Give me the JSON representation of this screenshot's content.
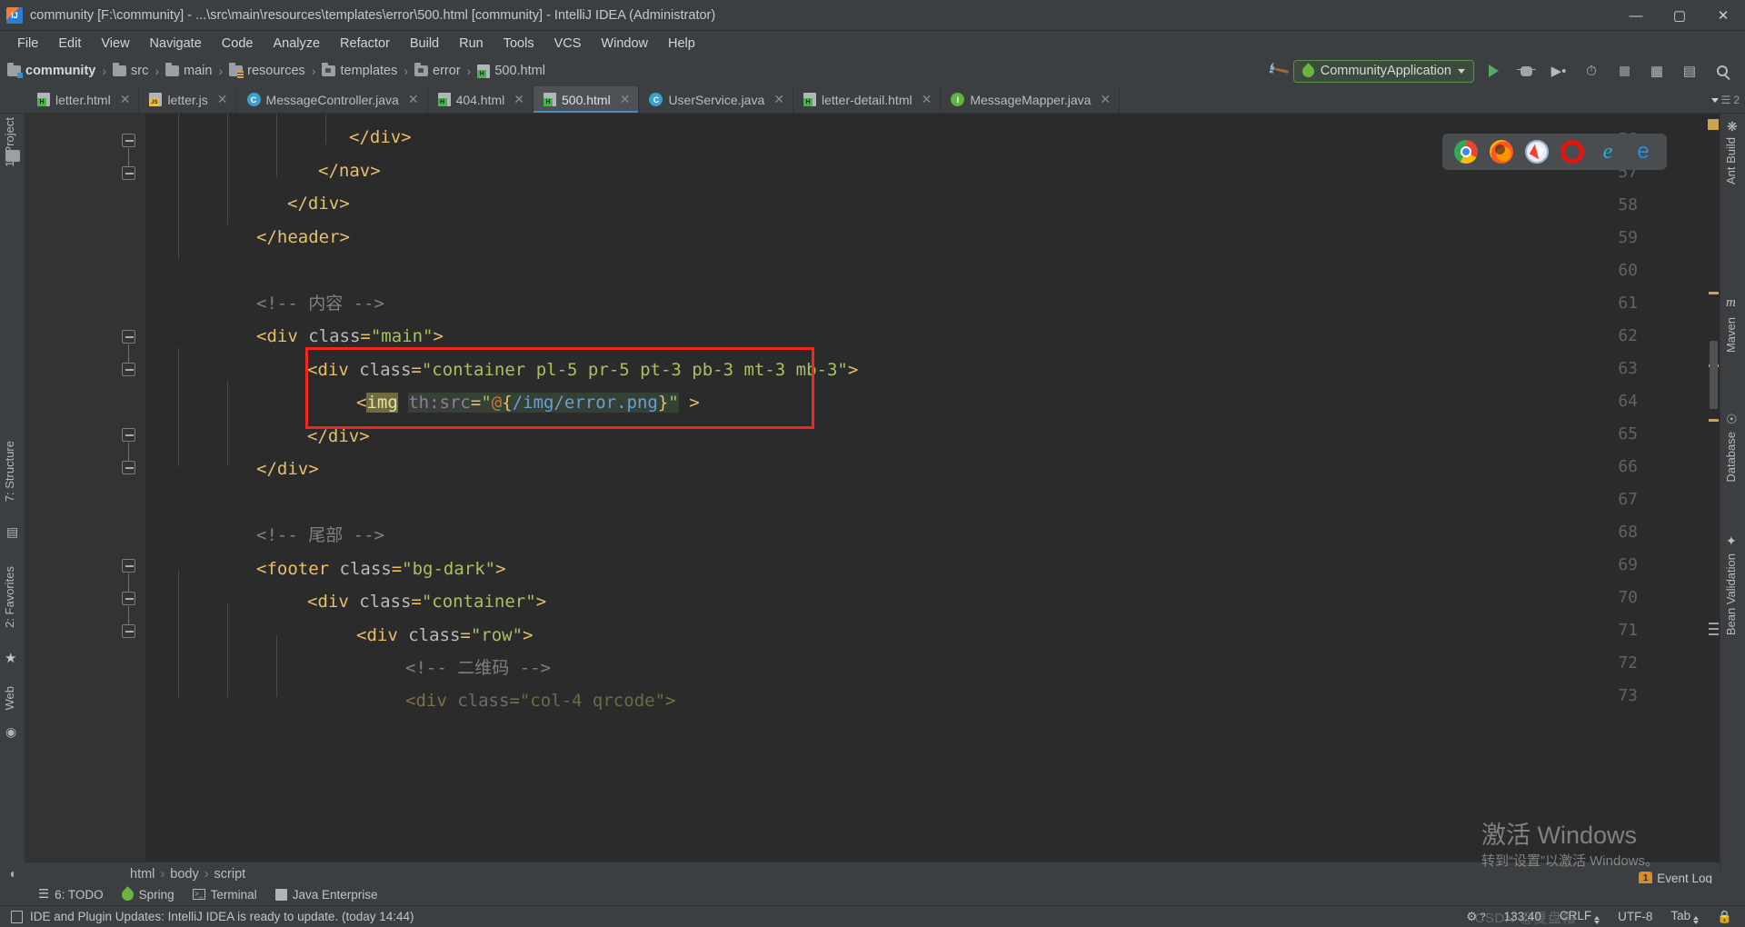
{
  "window": {
    "title": "community [F:\\community] - ...\\src\\main\\resources\\templates\\error\\500.html [community] - IntelliJ IDEA (Administrator)",
    "minimize": "—",
    "maximize": "▢",
    "close": "✕"
  },
  "menu": [
    {
      "label": "File"
    },
    {
      "label": "Edit"
    },
    {
      "label": "View"
    },
    {
      "label": "Navigate"
    },
    {
      "label": "Code"
    },
    {
      "label": "Analyze"
    },
    {
      "label": "Refactor"
    },
    {
      "label": "Build"
    },
    {
      "label": "Run"
    },
    {
      "label": "Tools"
    },
    {
      "label": "VCS"
    },
    {
      "label": "Window"
    },
    {
      "label": "Help"
    }
  ],
  "breadcrumb": {
    "items": [
      "community",
      "src",
      "main",
      "resources",
      "templates",
      "error",
      "500.html"
    ],
    "separator": "›"
  },
  "run_config": {
    "name": "CommunityApplication",
    "run_tooltip": "Run",
    "debug_tooltip": "Debug",
    "coverage_tooltip": "Run with Coverage",
    "profile_tooltip": "Profile",
    "stop_tooltip": "Stop",
    "search_tooltip": "Search Everywhere"
  },
  "tabs": [
    {
      "label": "letter.html",
      "icon": "html-file-icon",
      "active": false
    },
    {
      "label": "letter.js",
      "icon": "js-file-icon",
      "active": false
    },
    {
      "label": "MessageController.java",
      "icon": "java-class-icon",
      "active": false
    },
    {
      "label": "404.html",
      "icon": "html-file-icon",
      "active": false
    },
    {
      "label": "500.html",
      "icon": "html-file-icon",
      "active": true
    },
    {
      "label": "UserService.java",
      "icon": "java-class-icon",
      "active": false
    },
    {
      "label": "letter-detail.html",
      "icon": "html-file-icon",
      "active": false
    },
    {
      "label": "MessageMapper.java",
      "icon": "java-interface-icon",
      "active": false
    }
  ],
  "tab_overflow": "2",
  "left_tool_window": [
    {
      "label": "1: Project"
    },
    {
      "label": "7: Structure"
    },
    {
      "label": "2: Favorites"
    },
    {
      "label": "Web"
    }
  ],
  "right_tool_window": [
    {
      "label": "Ant Build"
    },
    {
      "label": "Maven"
    },
    {
      "label": "Database"
    },
    {
      "label": "Bean Validation"
    }
  ],
  "editor": {
    "first_line": 56,
    "lines": [
      {
        "num": 56,
        "indent": 5,
        "text": "</div>",
        "fold": true
      },
      {
        "num": 57,
        "indent": 4,
        "text": "</nav>",
        "fold": true
      },
      {
        "num": 58,
        "indent": 3,
        "text": "</div>",
        "fold": false
      },
      {
        "num": 59,
        "indent": 2,
        "text": "</header>",
        "fold": false
      },
      {
        "num": 60,
        "indent": 0,
        "text": "",
        "fold": false
      },
      {
        "num": 61,
        "indent": 2,
        "text": "<!-- 内容 -->",
        "fold": false
      },
      {
        "num": 62,
        "indent": 2,
        "text": "<div class=\"main\">",
        "fold": true
      },
      {
        "num": 63,
        "indent": 3,
        "text": "<div class=\"container pl-5 pr-5 pt-3 pb-3 mt-3 mb-3\">",
        "fold": true
      },
      {
        "num": 64,
        "indent": 4,
        "text": "<img th:src=\"@{/img/error.png}\" >",
        "fold": false
      },
      {
        "num": 65,
        "indent": 3,
        "text": "</div>",
        "fold": true
      },
      {
        "num": 66,
        "indent": 2,
        "text": "</div>",
        "fold": true
      },
      {
        "num": 67,
        "indent": 0,
        "text": "",
        "fold": false
      },
      {
        "num": 68,
        "indent": 2,
        "text": "<!-- 尾部 -->",
        "fold": false
      },
      {
        "num": 69,
        "indent": 2,
        "text": "<footer class=\"bg-dark\">",
        "fold": true
      },
      {
        "num": 70,
        "indent": 3,
        "text": "<div class=\"container\">",
        "fold": true
      },
      {
        "num": 71,
        "indent": 4,
        "text": "<div class=\"row\">",
        "fold": true
      },
      {
        "num": 72,
        "indent": 5,
        "text": "<!-- 二维码 -->",
        "fold": false
      },
      {
        "num": 73,
        "indent": 5,
        "text": "<div class=\"col-4 qrcode\">",
        "fold": false
      }
    ],
    "annotation_box": "red-highlight-rectangle"
  },
  "browser_popup": {
    "icons": [
      "chrome-icon",
      "firefox-icon",
      "safari-icon",
      "opera-icon",
      "ie-icon",
      "edge-icon"
    ],
    "glyphs": [
      "",
      "",
      "",
      "",
      "e",
      "e"
    ]
  },
  "bottom_breadcrumb": {
    "items": [
      "html",
      "body",
      "script"
    ],
    "separator": "›"
  },
  "bottom_tools": [
    {
      "label": "6: TODO",
      "icon": "todo-icon"
    },
    {
      "label": "Spring",
      "icon": "spring-leaf-icon"
    },
    {
      "label": "Terminal",
      "icon": "terminal-icon"
    },
    {
      "label": "Java Enterprise",
      "icon": "java-enterprise-icon"
    }
  ],
  "status_bar": {
    "message": "IDE and Plugin Updates: IntelliJ IDEA is ready to update. (today 14:44)",
    "caret_position": "133:40",
    "line_separator": "CRLF",
    "encoding": "UTF-8",
    "indent": "Tab",
    "gear_icon": "gear-question-icon",
    "event_log": "Event Log",
    "event_log_count": "1"
  },
  "watermark": {
    "line1": "激活 Windows",
    "line2": "转到“设置”以激活 Windows。",
    "csdn": "CSDN @夏盘帽"
  },
  "colors": {
    "background": "#3c3f41",
    "editor_bg": "#2b2b2b",
    "gutter_bg": "#313335",
    "accent_blue": "#4a88c7",
    "annotation_red": "#f5251f",
    "tag_orange": "#e8bf6a",
    "string_green": "#a5c261",
    "comment_gray": "#808080",
    "marker_yellow": "#c9a64d"
  }
}
